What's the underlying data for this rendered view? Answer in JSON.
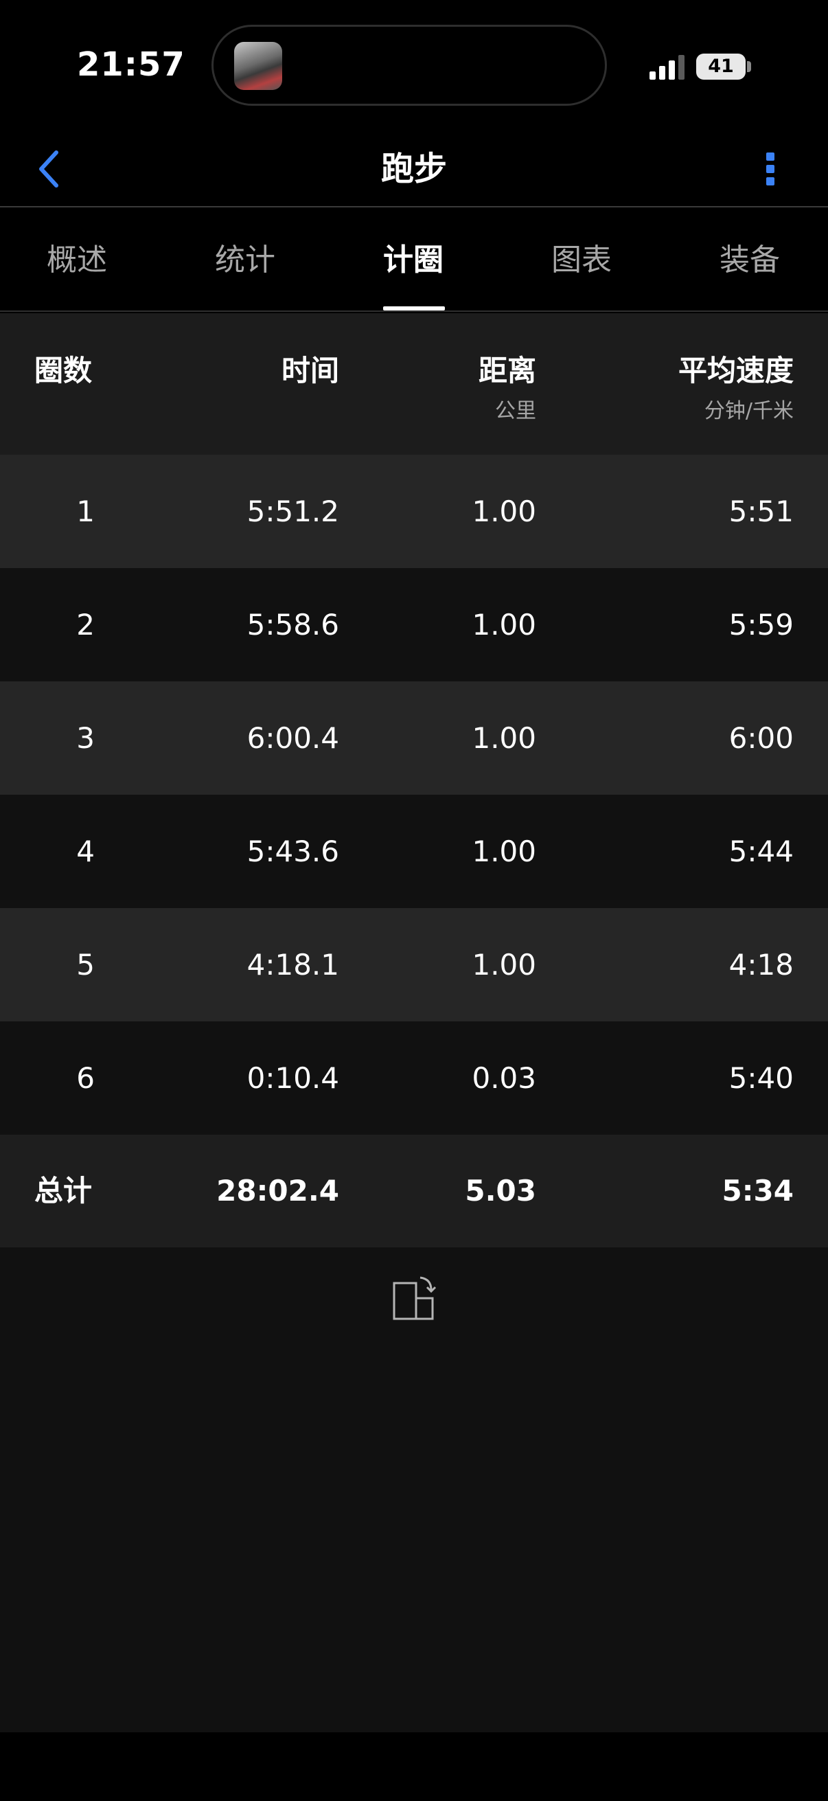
{
  "status_bar": {
    "time": "21:57",
    "battery": "41",
    "signal_icon": "cellular-signal-icon"
  },
  "header": {
    "title": "跑步",
    "back_icon": "chevron-left-icon",
    "more_icon": "more-vertical-icon",
    "accent_color": "#3b82f6"
  },
  "tabs": [
    {
      "label": "概述",
      "active": false
    },
    {
      "label": "统计",
      "active": false
    },
    {
      "label": "计圈",
      "active": true
    },
    {
      "label": "图表",
      "active": false
    },
    {
      "label": "装备",
      "active": false
    }
  ],
  "table": {
    "headers": {
      "lap": "圈数",
      "time": "时间",
      "distance": "距离",
      "distance_unit": "公里",
      "pace": "平均速度",
      "pace_unit": "分钟/千米"
    },
    "rows": [
      {
        "lap": "1",
        "time": "5:51.2",
        "distance": "1.00",
        "pace": "5:51"
      },
      {
        "lap": "2",
        "time": "5:58.6",
        "distance": "1.00",
        "pace": "5:59"
      },
      {
        "lap": "3",
        "time": "6:00.4",
        "distance": "1.00",
        "pace": "6:00"
      },
      {
        "lap": "4",
        "time": "5:43.6",
        "distance": "1.00",
        "pace": "5:44"
      },
      {
        "lap": "5",
        "time": "4:18.1",
        "distance": "1.00",
        "pace": "4:18"
      },
      {
        "lap": "6",
        "time": "0:10.4",
        "distance": "0.03",
        "pace": "5:40"
      }
    ],
    "total": {
      "label": "总计",
      "time": "28:02.4",
      "distance": "5.03",
      "pace": "5:34"
    }
  },
  "rotate_icon": "rotate-screen-icon"
}
